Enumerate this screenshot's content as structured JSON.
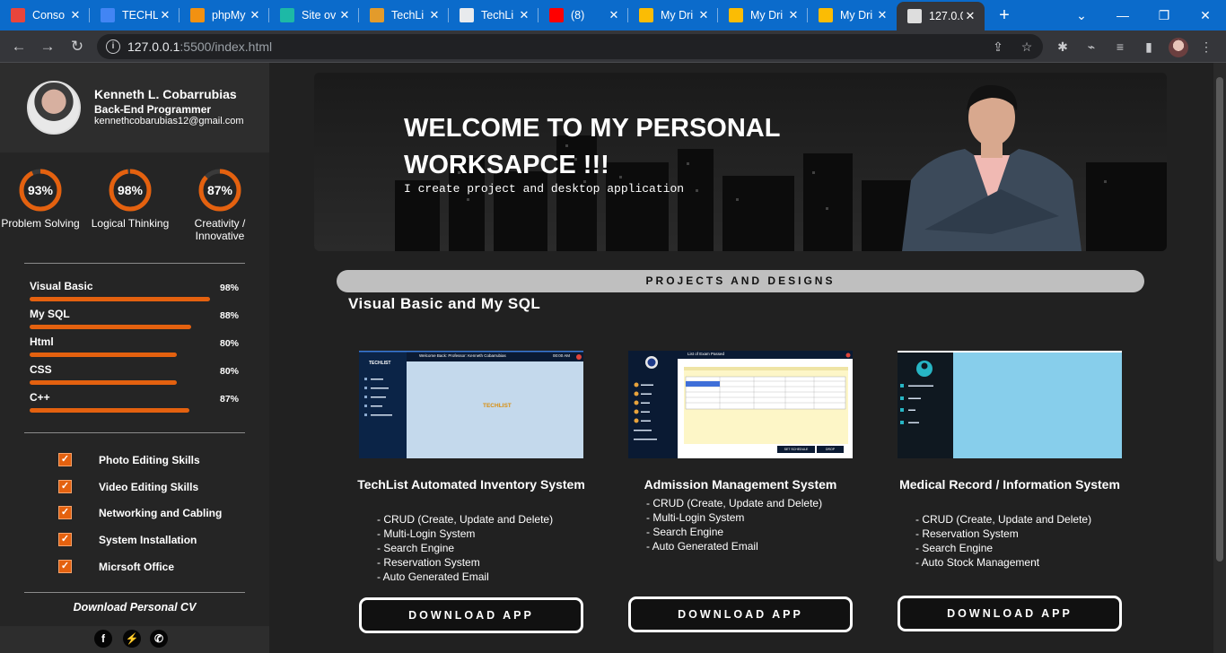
{
  "browser": {
    "tabs": [
      {
        "title": "Conso",
        "favicon": "console-icon",
        "color": "#e8453c"
      },
      {
        "title": "TECHL",
        "favicon": "docs-icon",
        "color": "#4285f4"
      },
      {
        "title": "phpMy",
        "favicon": "phpmyadmin-icon",
        "color": "#f29111"
      },
      {
        "title": "Site ov",
        "favicon": "site-icon",
        "color": "#1db9a6"
      },
      {
        "title": "TechLi",
        "favicon": "gear-icon",
        "color": "#e39b2b"
      },
      {
        "title": "TechLi",
        "favicon": "globe-icon",
        "color": "#e8eaed"
      },
      {
        "title": "(8)",
        "favicon": "youtube-icon",
        "color": "#ff0000"
      },
      {
        "title": "My Dri",
        "favicon": "drive-icon",
        "color": "#fbbc04"
      },
      {
        "title": "My Dri",
        "favicon": "drive-icon",
        "color": "#fbbc04"
      },
      {
        "title": "My Dri",
        "favicon": "drive-icon",
        "color": "#fbbc04"
      },
      {
        "title": "127.0.0",
        "favicon": "page-icon",
        "color": "#dddddd"
      }
    ],
    "url_host": "127.0.0.1",
    "url_path": ":5500/index.html"
  },
  "profile": {
    "name": "Kenneth L. Cobarrubias",
    "role": "Back-End Programmer",
    "email": "kennethcobarubias12@gmail.com"
  },
  "circles": [
    {
      "value": "93%",
      "label": "Problem Solving",
      "fraction": 0.93
    },
    {
      "value": "98%",
      "label": "Logical Thinking",
      "fraction": 0.98
    },
    {
      "value": "87%",
      "label": "Creativity / Innovative",
      "fraction": 0.87
    }
  ],
  "skills": [
    {
      "name": "Visual Basic",
      "value": "98%",
      "fraction": 0.98
    },
    {
      "name": "My SQL",
      "value": "88%",
      "fraction": 0.88
    },
    {
      "name": "Html",
      "value": "80%",
      "fraction": 0.8
    },
    {
      "name": "CSS",
      "value": "80%",
      "fraction": 0.8
    },
    {
      "name": "C++",
      "value": "87%",
      "fraction": 0.87
    }
  ],
  "checklist": [
    "Photo Editing Skills",
    "Video Editing Skills",
    "Networking and Cabling",
    "System Installation",
    "Micrsoft Office"
  ],
  "cv_label": "Download Personal CV",
  "hero": {
    "title": "WELCOME TO MY PERSONAL WORKSAPCE !!!",
    "subtitle": "I create project and desktop application"
  },
  "projects_heading": "PROJECTS AND DESIGNS",
  "section_title": "Visual Basic and My SQL",
  "cards": [
    {
      "title": "TechList Automated Inventory System",
      "features": [
        "- CRUD (Create, Update and Delete)",
        "- Multi-Login System",
        "- Search Engine",
        "- Reservation System",
        "- Auto Generated Email"
      ],
      "button": "DOWNLOAD APP",
      "thumb_header": "Welcome Back: Professor: Kenneth Cobarrubias",
      "thumb_time": "00:00 AM",
      "thumb_brand": "TECHLIST"
    },
    {
      "title": "Admission Management System",
      "features": [
        "- CRUD (Create, Update and Delete)",
        "- Multi-Login System",
        "- Search Engine",
        "- Auto Generated Email"
      ],
      "button": "DOWNLOAD APP",
      "thumb_header": "List of Exam Passed",
      "thumb_btn1": "SET SCHEDULE",
      "thumb_btn2": "DROP"
    },
    {
      "title": "Medical Record / Information System",
      "features": [
        "- CRUD (Create, Update and Delete)",
        "- Reservation System",
        "- Search Engine",
        "- Auto Stock Management"
      ],
      "button": "DOWNLOAD APP"
    }
  ],
  "colors": {
    "accent": "#e4610f",
    "page_bg": "#212121",
    "sidebar_bg": "#252525"
  }
}
